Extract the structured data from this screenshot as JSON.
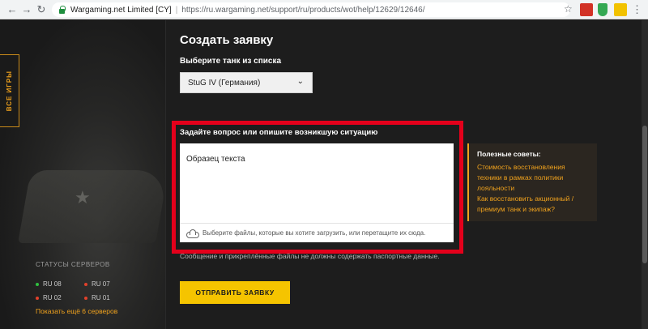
{
  "browser": {
    "site_label": "Wargaming.net Limited [CY]",
    "url": "https://ru.wargaming.net/support/ru/products/wot/help/12629/12646/",
    "icons": [
      "back-arrow-icon",
      "forward-arrow-icon",
      "reload-icon",
      "lock-icon",
      "star-icon",
      "menu-dots-icon"
    ]
  },
  "sidebar": {
    "all_games": "ВСЕ ИГРЫ",
    "servers_title": "СТАТУСЫ СЕРВЕРОВ",
    "servers": [
      {
        "name": "RU 08",
        "status_color": "#2fbf3f"
      },
      {
        "name": "RU 07",
        "status_color": "#e2412b"
      },
      {
        "name": "RU 02",
        "status_color": "#e2412b"
      },
      {
        "name": "RU 01",
        "status_color": "#e2412b"
      }
    ],
    "show_more": "Показать ещё 6 серверов"
  },
  "form": {
    "title": "Создать заявку",
    "tank_label": "Выберите танк из списка",
    "tank_selected": "StuG IV (Германия)",
    "question_label": "Задайте вопрос или опишите возникшую ситуацию",
    "textarea_value": "Образец текста",
    "upload_hint": "Выберите файлы, которые вы хотите загрузить, или перетащите их сюда.",
    "note": "Сообщение и прикреплённые файлы не должны содержать паспортные данные.",
    "submit_label": "ОТПРАВИТЬ ЗАЯВКУ"
  },
  "tips": {
    "title": "Полезные советы:",
    "links": [
      "Стоимость восстановления",
      "техники в рамках политики",
      "лояльности",
      "Как восстановить акционный /",
      "премиум танк и экипаж?"
    ]
  },
  "colors": {
    "accent": "#f0a21d",
    "button": "#f5c400",
    "highlight_border": "#e4001b"
  }
}
